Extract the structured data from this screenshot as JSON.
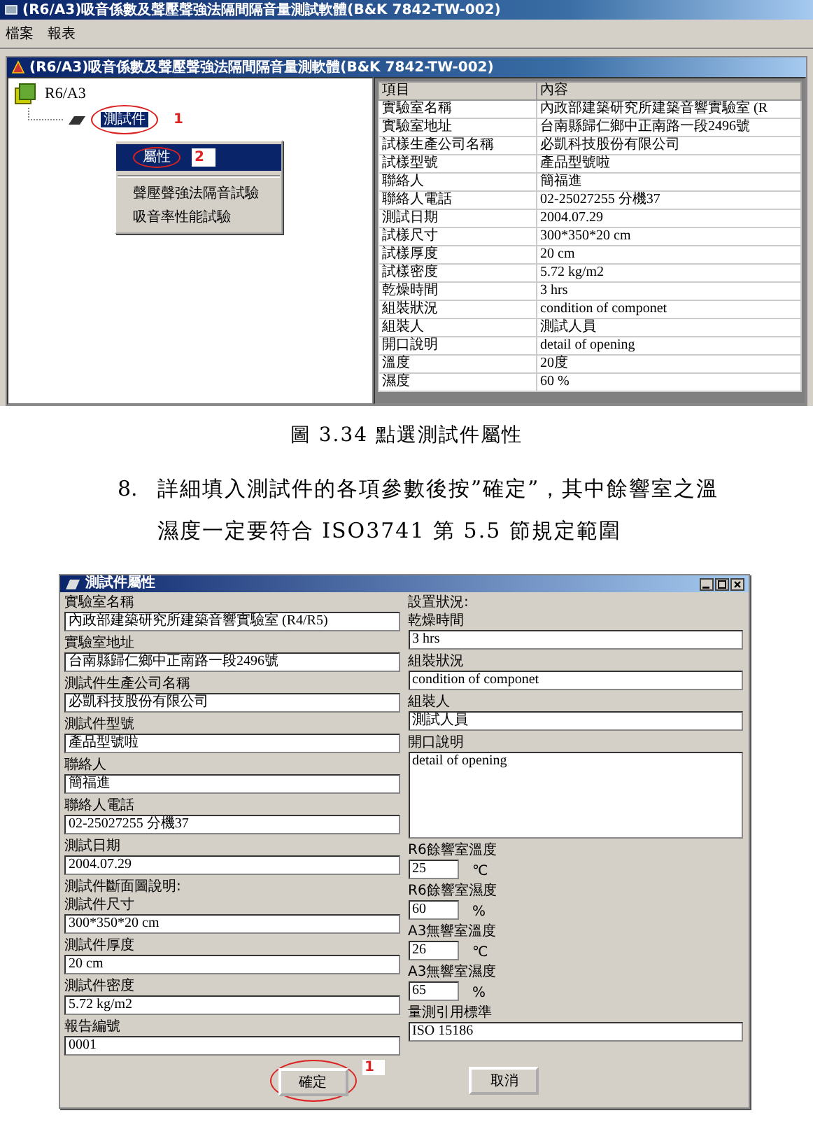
{
  "app_window": {
    "title": "(R6/A3)吸音係數及聲壓聲強法隔間隔音量測試軟體(B&K 7842-TW-002)",
    "menu": [
      "檔案",
      "報表"
    ],
    "child_window": {
      "title": "(R6/A3)吸音係數及聲壓聲強法隔間隔音量測軟體(B&K 7842-TW-002)",
      "tree": [
        {
          "label": "R6/A3",
          "selected": false,
          "children": [
            {
              "label": "測試件",
              "selected": true,
              "annotation": "1"
            }
          ]
        }
      ],
      "context_menu": {
        "items": [
          {
            "kind": "item",
            "label": "屬性",
            "selected": true,
            "annotation": "2"
          },
          {
            "kind": "separator"
          },
          {
            "kind": "item",
            "label": "聲壓聲強法隔音試驗",
            "selected": false
          },
          {
            "kind": "item",
            "label": "吸音率性能試驗",
            "selected": false
          }
        ]
      },
      "table": {
        "columns": [
          "項目",
          "內容"
        ],
        "rows": [
          [
            "實驗室名稱",
            "內政部建築研究所建築音響實驗室 (R"
          ],
          [
            "實驗室地址",
            "台南縣歸仁鄉中正南路一段2496號"
          ],
          [
            "試樣生產公司名稱",
            "必凱科技股份有限公司"
          ],
          [
            "試樣型號",
            "產品型號啦"
          ],
          [
            "聯絡人",
            "簡福進"
          ],
          [
            "聯絡人電話",
            "02-25027255 分機37"
          ],
          [
            "測試日期",
            "2004.07.29"
          ],
          [
            "試樣尺寸",
            "300*350*20 cm"
          ],
          [
            "試樣厚度",
            "20 cm"
          ],
          [
            "試樣密度",
            "5.72 kg/m2"
          ],
          [
            "乾燥時間",
            "3 hrs"
          ],
          [
            "組裝狀況",
            "condition of componet"
          ],
          [
            "組裝人",
            "測試人員"
          ],
          [
            "開口說明",
            "detail of opening"
          ],
          [
            "溫度",
            "20度"
          ],
          [
            "濕度",
            "60 %"
          ]
        ]
      }
    }
  },
  "caption": "圖 3.34 點選測試件屬性",
  "step": {
    "number": "8.",
    "lines": [
      "詳細填入測試件的各項參數後按”確定”，其中餘響室之溫",
      "濕度一定要符合 ISO3741 第 5.5 節規定範圍"
    ]
  },
  "dialog": {
    "title": "測試件屬性",
    "left_fields": [
      {
        "kind": "field",
        "label": "實驗室名稱",
        "value": "內政部建築研究所建築音響實驗室 (R4/R5)"
      },
      {
        "kind": "field",
        "label": "實驗室地址",
        "value": "台南縣歸仁鄉中正南路一段2496號"
      },
      {
        "kind": "field",
        "label": "測試件生產公司名稱",
        "value": "必凱科技股份有限公司"
      },
      {
        "kind": "field",
        "label": "測試件型號",
        "value": "產品型號啦"
      },
      {
        "kind": "field",
        "label": "聯絡人",
        "value": "簡福進"
      },
      {
        "kind": "field",
        "label": "聯絡人電話",
        "value": "02-25027255 分機37"
      },
      {
        "kind": "field",
        "label": "測試日期",
        "value": "2004.07.29"
      },
      {
        "kind": "heading",
        "label": "測試件斷面圖說明:"
      },
      {
        "kind": "field",
        "label": "測試件尺寸",
        "value": "300*350*20 cm"
      },
      {
        "kind": "field",
        "label": "測試件厚度",
        "value": "20 cm"
      },
      {
        "kind": "field",
        "label": "測試件密度",
        "value": "5.72 kg/m2"
      },
      {
        "kind": "field",
        "label": "報告編號",
        "value": "0001"
      }
    ],
    "right_fields": [
      {
        "kind": "heading",
        "label": "設置狀況:"
      },
      {
        "kind": "field",
        "label": "乾燥時間",
        "value": "3 hrs"
      },
      {
        "kind": "field",
        "label": "組裝狀況",
        "value": "condition of componet"
      },
      {
        "kind": "field",
        "label": "組裝人",
        "value": "測試人員"
      },
      {
        "kind": "textarea",
        "label": "開口說明",
        "value": "detail of opening"
      },
      {
        "kind": "short",
        "label": "R6餘響室溫度",
        "value": "25",
        "unit": "℃"
      },
      {
        "kind": "short",
        "label": "R6餘響室濕度",
        "value": "60",
        "unit": "%"
      },
      {
        "kind": "short",
        "label": "A3無響室溫度",
        "value": "26",
        "unit": "℃"
      },
      {
        "kind": "short",
        "label": "A3無響室濕度",
        "value": "65",
        "unit": "%"
      },
      {
        "kind": "field",
        "label": "量測引用標準",
        "value": "ISO 15186"
      }
    ],
    "buttons": [
      {
        "label": "確定",
        "annotation": "1"
      },
      {
        "label": "取消"
      }
    ]
  }
}
